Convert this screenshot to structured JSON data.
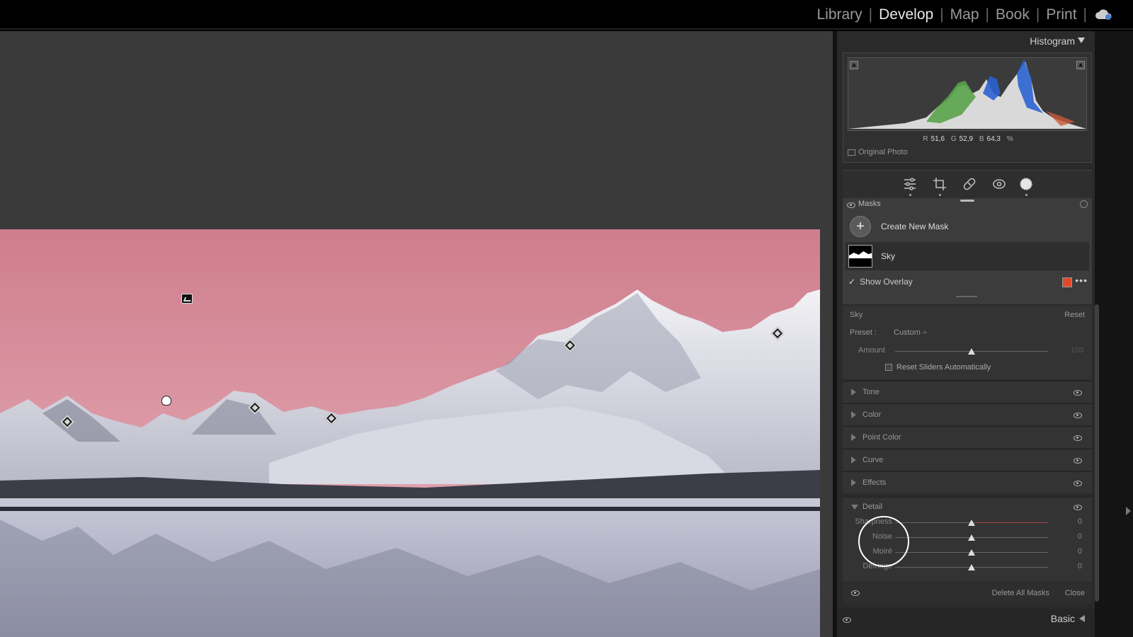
{
  "top_nav": {
    "modules": [
      "Library",
      "Develop",
      "Map",
      "Book",
      "Print"
    ],
    "active": "Develop",
    "separator": "|",
    "cloud_icon": "cloud-sync-icon"
  },
  "histogram": {
    "title": "Histogram",
    "readout": {
      "r_label": "R",
      "r": "51,6",
      "g_label": "G",
      "g": "52,9",
      "b_label": "B",
      "b": "64,3",
      "unit": "%"
    },
    "original_photo_label": "Original Photo"
  },
  "tools": [
    "edit-sliders-icon",
    "crop-icon",
    "healing-icon",
    "red-eye-icon",
    "masking-icon"
  ],
  "masks": {
    "header": "Masks",
    "create_label": "Create New Mask",
    "mask_name": "Sky",
    "show_overlay_label": "Show Overlay",
    "overlay_color": "#e3482b",
    "more": "•••"
  },
  "sky_panel": {
    "title": "Sky",
    "reset": "Reset",
    "preset_label": "Preset :",
    "preset_value": "Custom ÷",
    "amount_label": "Amount",
    "amount_value": "100",
    "amount": 50,
    "reset_sliders_label": "Reset Sliders Automatically"
  },
  "sections": [
    "Tone",
    "Color",
    "Point Color",
    "Curve",
    "Effects"
  ],
  "detail": {
    "title": "Detail",
    "sliders": [
      {
        "label": "Sharpness",
        "value": "0",
        "level": 0.5
      },
      {
        "label": "Noise",
        "value": "0",
        "level": 0.5
      },
      {
        "label": "Moiré",
        "value": "0",
        "level": 0.5
      },
      {
        "label": "Defringe",
        "value": "0",
        "level": 0.5
      }
    ]
  },
  "footer": {
    "delete_all": "Delete All Masks",
    "close": "Close"
  },
  "bottom_panel": {
    "label": "Basic"
  },
  "colors": {
    "sky_pink": "#d98a97",
    "accent_overlay": "#e3482b"
  }
}
